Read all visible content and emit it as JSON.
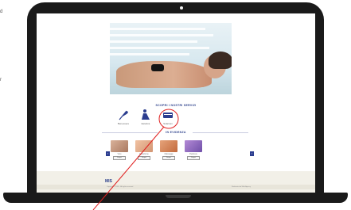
{
  "left_margin": {
    "char_top": "d",
    "char_bottom": "r"
  },
  "section": {
    "title": "SCOPRI I NOSTRI SERVIZI",
    "promo_title": "IN EVIDENZA"
  },
  "services": [
    {
      "label": "Benessere",
      "icon": "feather-icon"
    },
    {
      "label": "Estetica",
      "icon": "person-icon"
    },
    {
      "label": "Solarium",
      "icon": "sunbed-icon"
    }
  ],
  "promos": [
    {
      "label": "Viso",
      "button": "Scopri"
    },
    {
      "label": "Epilazione",
      "button": "Scopri"
    },
    {
      "label": "Massaggi",
      "button": "Scopri"
    },
    {
      "label": "Pedicure",
      "button": "Scopri"
    }
  ],
  "footer": {
    "logo": "MIS",
    "copyright": "Copyright © 2018 · All rights reserved",
    "right": "Realizzato da Web Agency"
  },
  "colors": {
    "accent": "#2b3d8f",
    "highlight_circle": "#e02020"
  }
}
